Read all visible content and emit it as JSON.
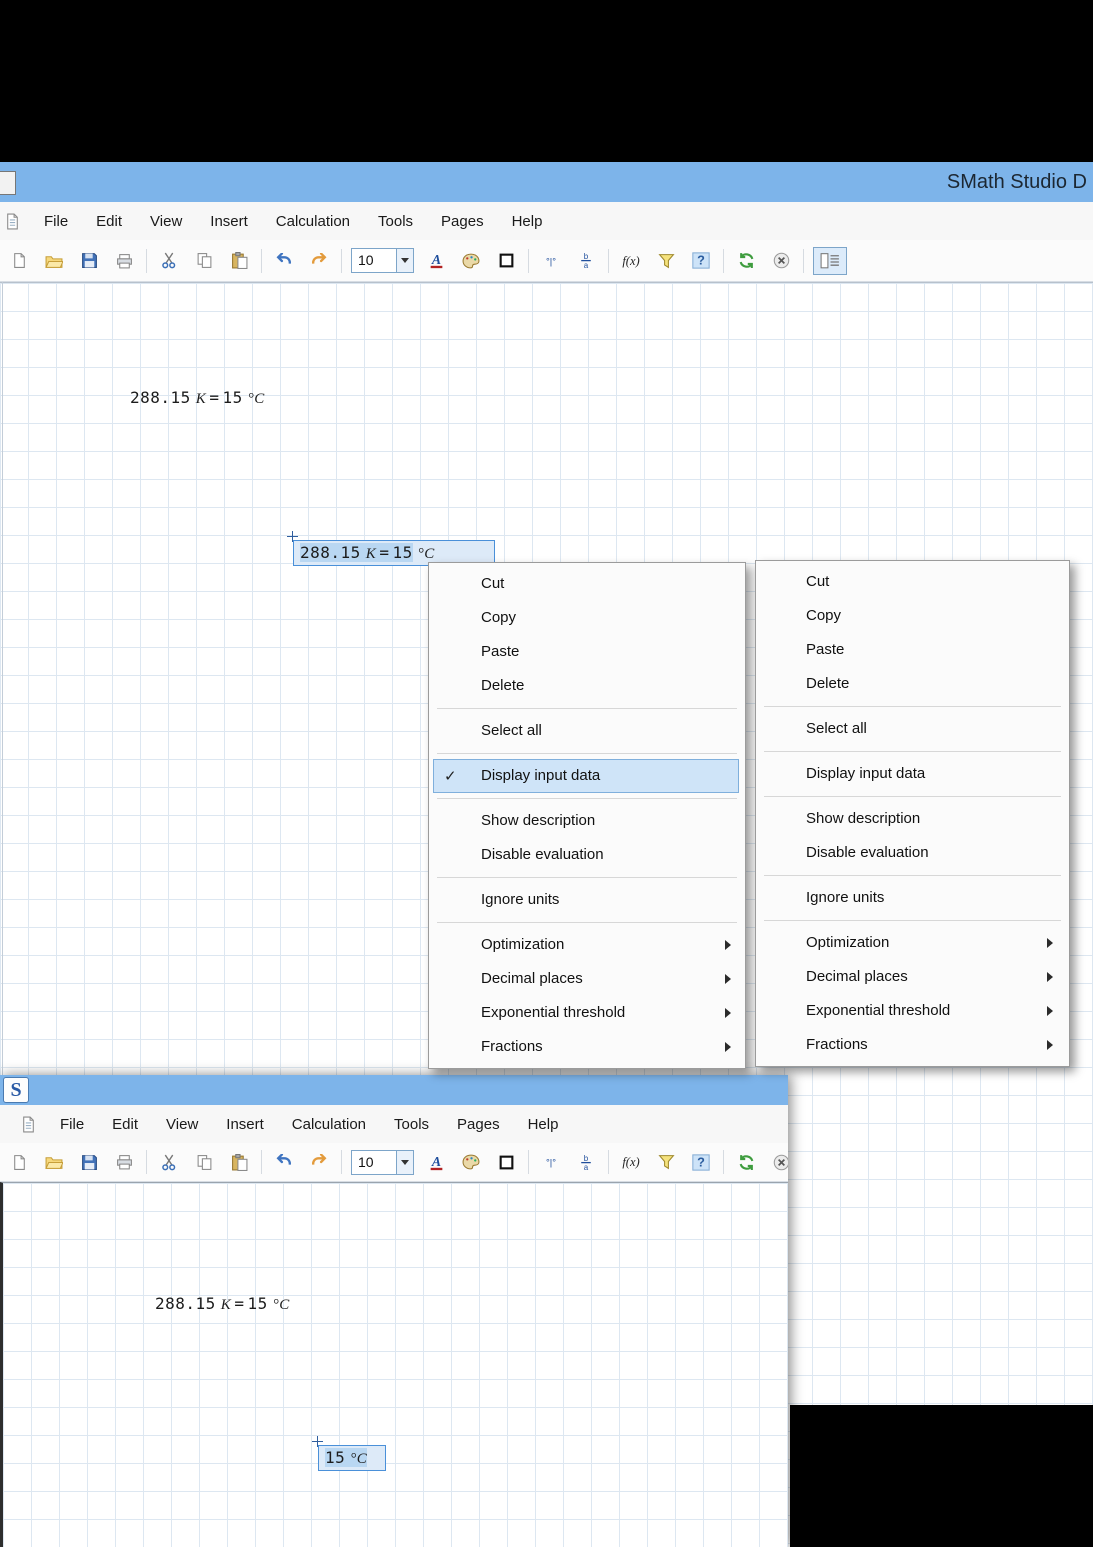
{
  "window1": {
    "title": "SMath Studio D"
  },
  "window2": {
    "logo": "S"
  },
  "menubar": {
    "items": [
      "File",
      "Edit",
      "View",
      "Insert",
      "Calculation",
      "Tools",
      "Pages",
      "Help"
    ]
  },
  "toolbar": {
    "font_size": "10",
    "items": [
      "new",
      "open",
      "save",
      "print",
      "sep",
      "cut",
      "copy",
      "paste",
      "sep",
      "undo",
      "redo",
      "sep",
      "fontsize",
      "fontcolor",
      "palette",
      "border",
      "sep",
      "units",
      "fraction",
      "sep",
      "fx",
      "filter",
      "help",
      "sep",
      "refresh",
      "cancel",
      "sep",
      "pagesetup"
    ]
  },
  "worksheet1": {
    "expression": {
      "value": "288.15",
      "unit": "K",
      "equals": "=",
      "result": "15",
      "result_unit": "°C"
    },
    "selected": {
      "value": "288.15",
      "unit": "K",
      "equals": "=",
      "result": "15",
      "result_unit": "°C"
    }
  },
  "worksheet2": {
    "expression": {
      "value": "288.15",
      "unit": "K",
      "equals": "=",
      "result": "15",
      "result_unit": "°C"
    },
    "selected": {
      "result": "15",
      "result_unit": "°C"
    }
  },
  "context_menu_1": {
    "items": [
      {
        "label": "Cut"
      },
      {
        "label": "Copy"
      },
      {
        "label": "Paste"
      },
      {
        "label": "Delete",
        "sep_after": true
      },
      {
        "label": "Select all",
        "sep_after": true
      },
      {
        "label": "Display input data",
        "checked": true,
        "highlighted": true,
        "sep_after": true
      },
      {
        "label": "Show description"
      },
      {
        "label": "Disable evaluation",
        "sep_after": true
      },
      {
        "label": "Ignore units",
        "sep_after": true
      },
      {
        "label": "Optimization",
        "submenu": true
      },
      {
        "label": "Decimal places",
        "submenu": true
      },
      {
        "label": "Exponential threshold",
        "submenu": true
      },
      {
        "label": "Fractions",
        "submenu": true
      }
    ]
  },
  "context_menu_2": {
    "items": [
      {
        "label": "Cut"
      },
      {
        "label": "Copy"
      },
      {
        "label": "Paste"
      },
      {
        "label": "Delete",
        "sep_after": true
      },
      {
        "label": "Select all",
        "sep_after": true
      },
      {
        "label": "Display input data",
        "sep_after": true
      },
      {
        "label": "Show description"
      },
      {
        "label": "Disable evaluation",
        "sep_after": true
      },
      {
        "label": "Ignore units",
        "sep_after": true
      },
      {
        "label": "Optimization",
        "submenu": true
      },
      {
        "label": "Decimal places",
        "submenu": true
      },
      {
        "label": "Exponential threshold",
        "submenu": true
      },
      {
        "label": "Fractions",
        "submenu": true
      }
    ]
  },
  "colors": {
    "titlebar": "#7db4ea",
    "selection_fill": "#b9d7f2",
    "selection_border": "#4a90d9",
    "menu_highlight": "#cfe4f8",
    "menu_highlight_border": "#7fafdc"
  }
}
